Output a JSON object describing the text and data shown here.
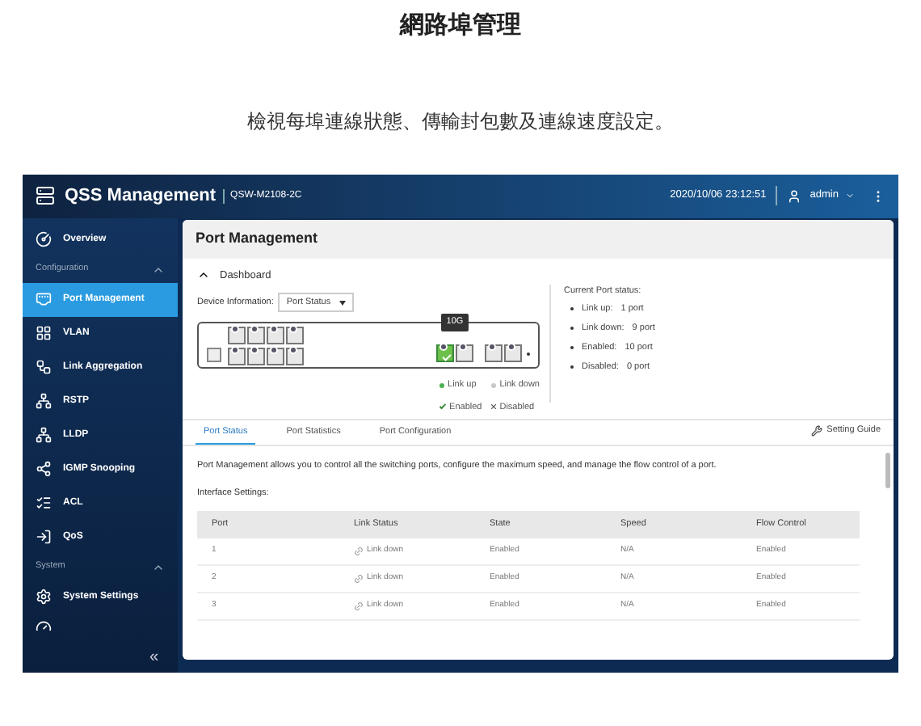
{
  "page_title": "網路埠管理",
  "subtitle": "檢視每埠連線狀態、傳輸封包數及連線速度設定。",
  "header": {
    "app_name": "QSS Management",
    "model": "QSW-M2108-2C",
    "datetime": "2020/10/06  23:12:51",
    "user": "admin"
  },
  "sidebar": {
    "items": [
      {
        "kind": "item",
        "label": "Overview",
        "selected": false
      },
      {
        "kind": "section",
        "label": "Configuration",
        "expanded": true
      },
      {
        "kind": "item",
        "label": "Port Management",
        "selected": true
      },
      {
        "kind": "item",
        "label": "VLAN",
        "selected": false
      },
      {
        "kind": "item",
        "label": "Link Aggregation",
        "selected": false
      },
      {
        "kind": "item",
        "label": "RSTP",
        "selected": false
      },
      {
        "kind": "item",
        "label": "LLDP",
        "selected": false
      },
      {
        "kind": "item",
        "label": "IGMP Snooping",
        "selected": false
      },
      {
        "kind": "item",
        "label": "ACL",
        "selected": false
      },
      {
        "kind": "item",
        "label": "QoS",
        "selected": false
      },
      {
        "kind": "section",
        "label": "System",
        "expanded": true
      },
      {
        "kind": "item",
        "label": "System Settings",
        "selected": false
      }
    ],
    "collapse": "«"
  },
  "panel": {
    "title": "Port Management",
    "dashboard": {
      "title": "Dashboard",
      "expanded": true,
      "device_info_label": "Device Information:",
      "device_info_value": "Port Status",
      "copper_top": [
        {
          "link_up": false
        },
        {
          "link_up": false
        },
        {
          "link_up": false
        },
        {
          "link_up": false
        }
      ],
      "copper_bottom": [
        {
          "link_up": false
        },
        {
          "link_up": false
        },
        {
          "link_up": false
        },
        {
          "link_up": false
        }
      ],
      "tooltip": "10G",
      "sfp": [
        {
          "link_up": true
        },
        {
          "link_up": false
        }
      ],
      "sfp_extra": [
        {
          "link_up": false
        },
        {
          "link_up": false
        }
      ],
      "legend": [
        {
          "kind": "dot",
          "label": "Link up",
          "color": "#4caf50"
        },
        {
          "kind": "dot",
          "label": "Link down",
          "color": "#c8c8c8"
        },
        {
          "kind": "check",
          "label": "Enabled"
        },
        {
          "kind": "cross",
          "label": "Disabled"
        }
      ],
      "status_title": "Current Port status:",
      "status": [
        {
          "label": "Link up:",
          "value": "1 port"
        },
        {
          "label": "Link down:",
          "value": "9 port"
        },
        {
          "label": "Enabled:",
          "value": "10 port"
        },
        {
          "label": "Disabled:",
          "value": "0 port"
        }
      ]
    },
    "tabs": [
      {
        "label": "Port Status",
        "selected": true
      },
      {
        "label": "Port Statistics",
        "selected": false
      },
      {
        "label": "Port Configuration",
        "selected": false
      }
    ],
    "setting_guide": "Setting Guide",
    "description": "Port Management allows you to control all the switching ports, configure the maximum speed, and manage the flow control of a port.",
    "interface_label": "Interface Settings:",
    "table": {
      "columns": [
        "Port",
        "Link Status",
        "State",
        "Speed",
        "Flow Control"
      ],
      "rows": [
        [
          "1",
          "Link down",
          "Enabled",
          "N/A",
          "Enabled"
        ],
        [
          "2",
          "Link down",
          "Enabled",
          "N/A",
          "Enabled"
        ],
        [
          "3",
          "Link down",
          "Enabled",
          "N/A",
          "Enabled"
        ]
      ]
    }
  }
}
